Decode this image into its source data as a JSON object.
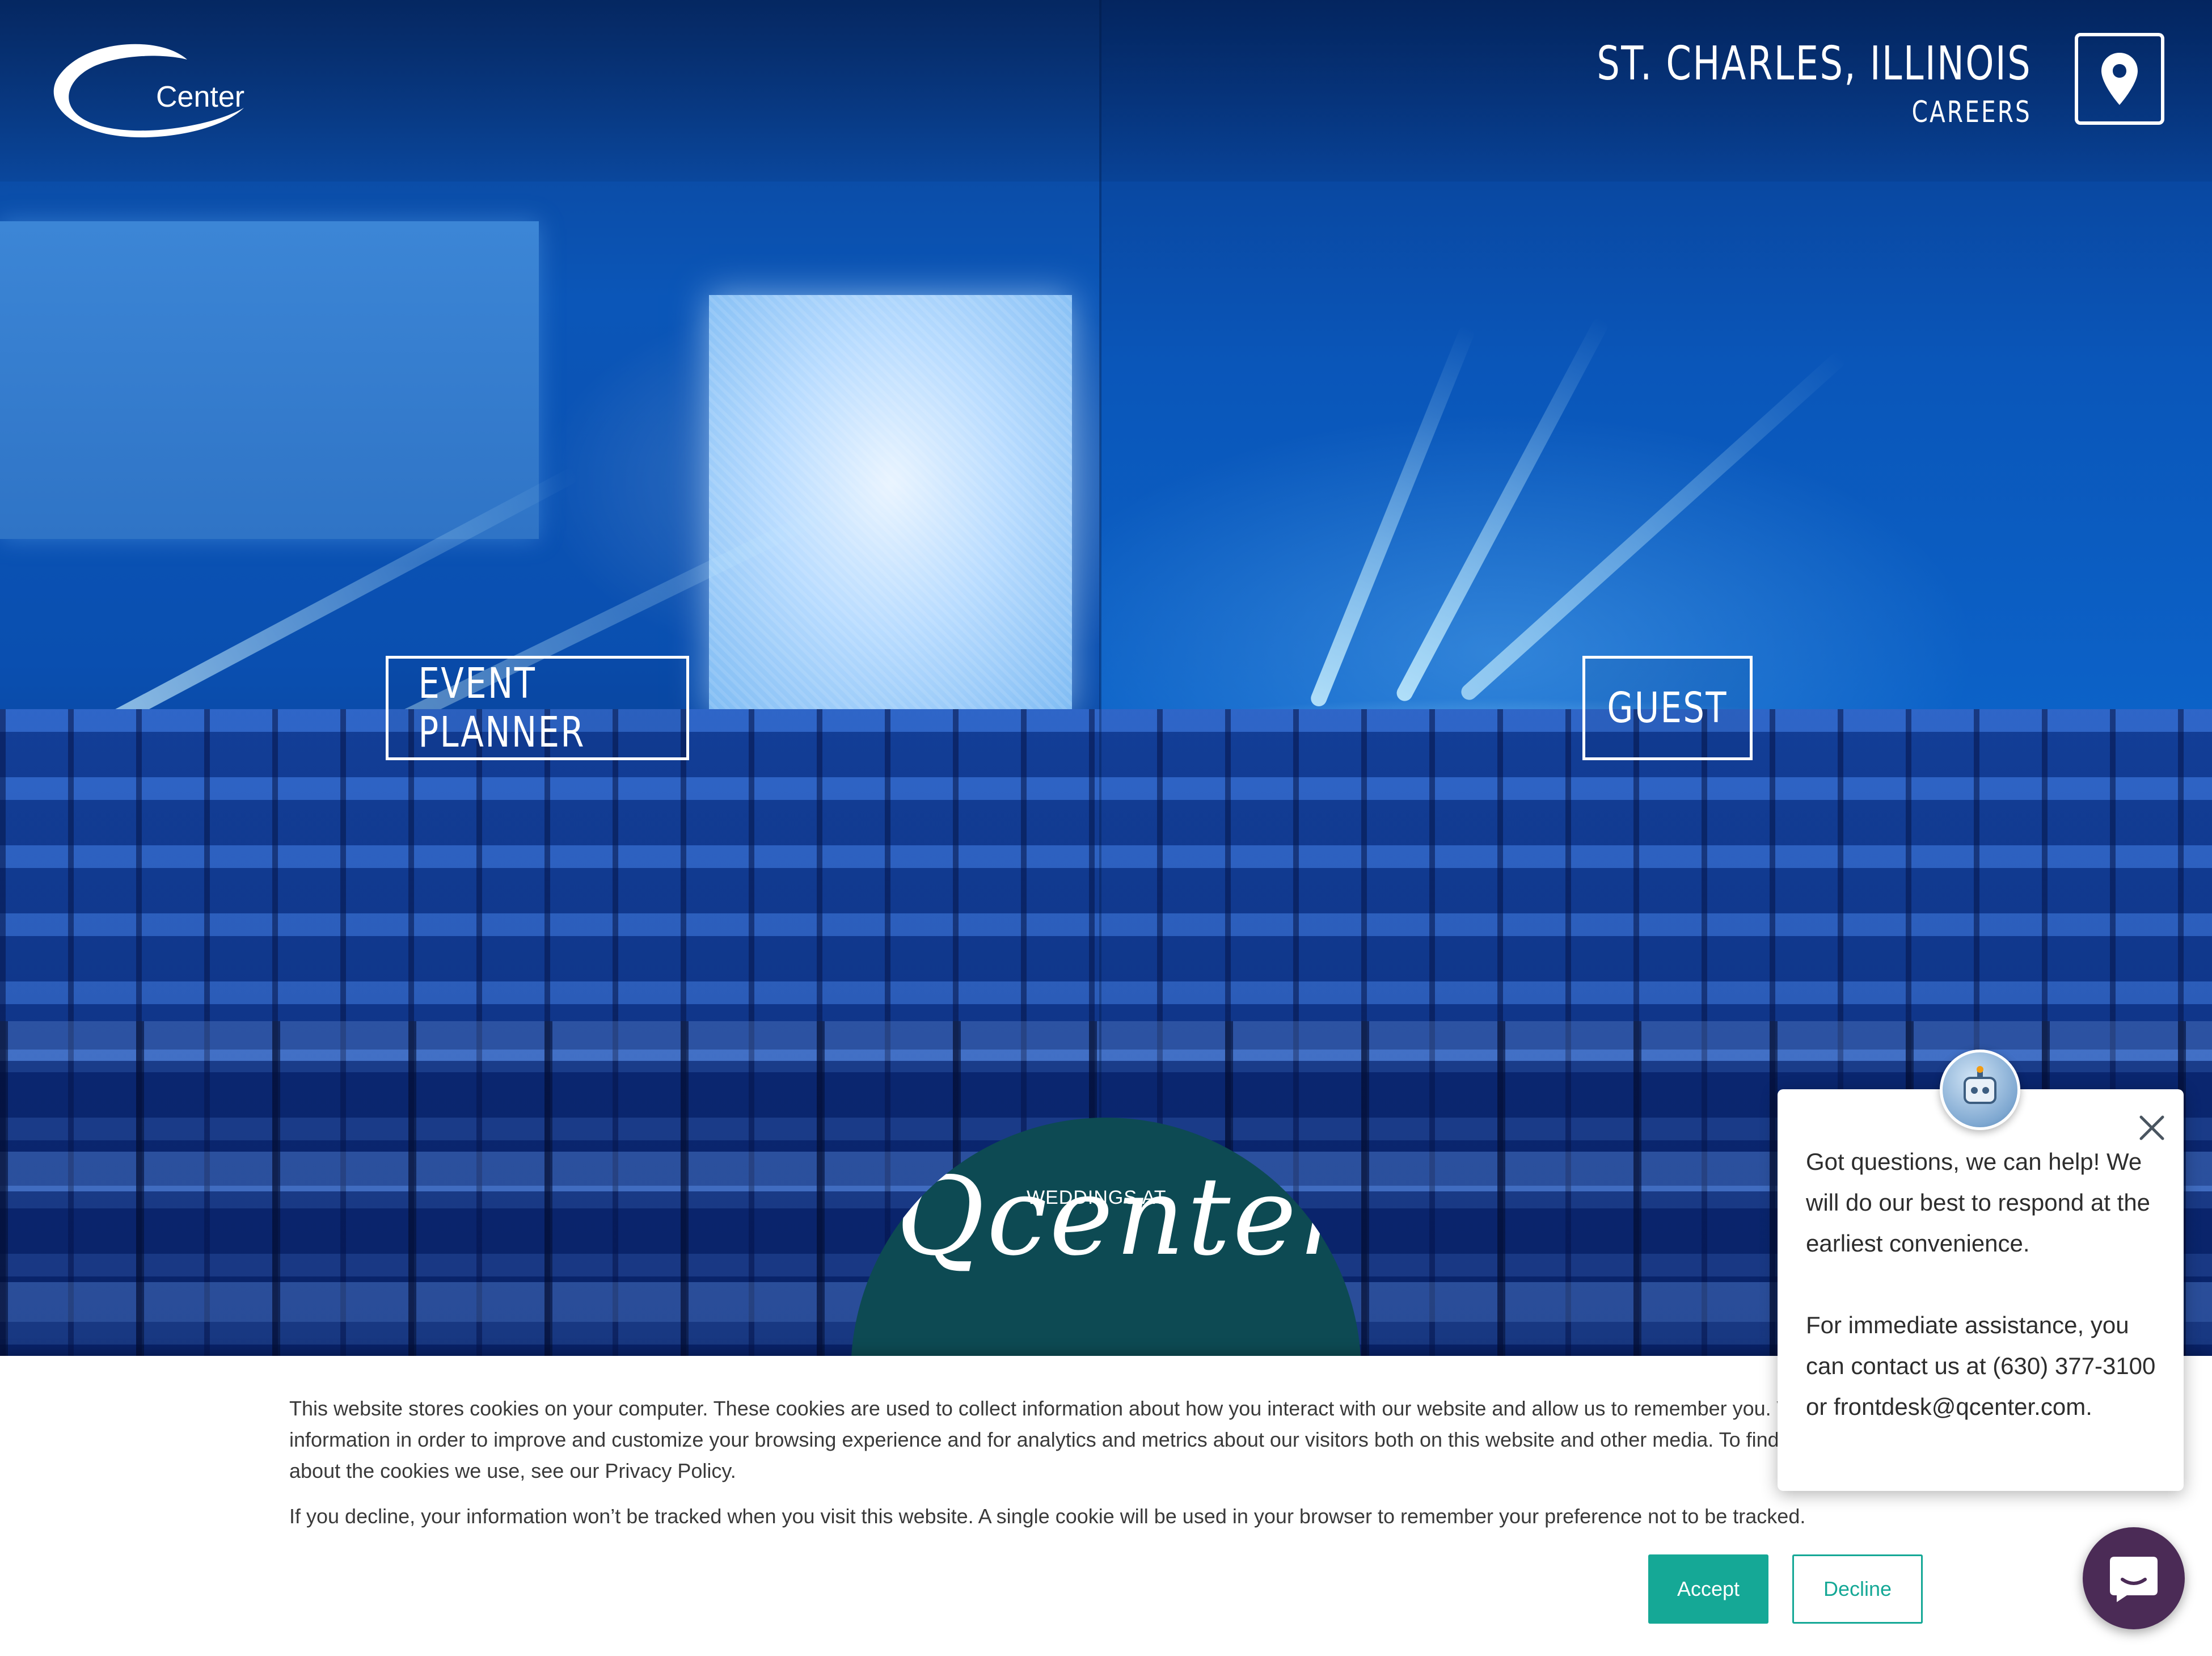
{
  "header": {
    "logo_text": "Center",
    "location_title": "ST. CHARLES, ILLINOIS",
    "careers_label": "CAREERS",
    "map_icon": "map-pin-icon"
  },
  "hero": {
    "event_planner_label": "EVENT PLANNER",
    "guest_label": "GUEST"
  },
  "wedding_badge": {
    "small_text": "WEDDINGS AT",
    "script_text": "Qcenter"
  },
  "cookie_banner": {
    "text_1": "This website stores cookies on your computer. These cookies are used to collect information about how you interact with our website and allow us to remember you. We use this information in order to improve and customize your browsing experience and for analytics and metrics about our visitors both on this website and other media. To find out more about the cookies we use, see our Privacy Policy.",
    "text_2": "If you decline, your information won’t be tracked when you visit this website. A single cookie will be used in your browser to remember your preference not to be tracked.",
    "accept_label": "Accept",
    "decline_label": "Decline",
    "accent_color": "#15a896"
  },
  "chat": {
    "message_1": "Got questions, we can help! We will do our best to respond at the earliest convenience.",
    "message_2": "For immediate assistance, you can contact us at (630) 377-3100 or frontdesk@qcenter.com.",
    "launcher_color": "#4b2b56"
  },
  "colors": {
    "wedding_badge": "#0d4a53",
    "hero_blue": "#0a4fb0"
  }
}
